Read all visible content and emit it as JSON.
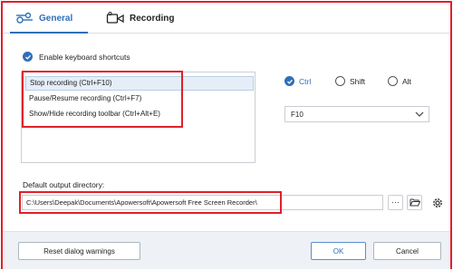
{
  "tabs": [
    {
      "label": "General",
      "icon": "sliders-icon",
      "active": true
    },
    {
      "label": "Recording",
      "icon": "video-camera-icon",
      "active": false
    }
  ],
  "keyboard": {
    "enable_label": "Enable keyboard shortcuts",
    "enabled": true,
    "items": [
      {
        "label": "Stop recording (Ctrl+F10)",
        "selected": true
      },
      {
        "label": "Pause/Resume recording (Ctrl+F7)",
        "selected": false
      },
      {
        "label": "Show/Hide recording toolbar (Ctrl+Alt+E)",
        "selected": false
      }
    ],
    "modifiers": [
      {
        "label": "Ctrl",
        "checked": true
      },
      {
        "label": "Shift",
        "checked": false
      },
      {
        "label": "Alt",
        "checked": false
      }
    ],
    "key_value": "F10"
  },
  "output": {
    "label": "Default output directory:",
    "path": "C:\\Users\\Deepak\\Documents\\Apowersoft\\Apowersoft Free Screen Recorder\\",
    "browse_label": "···"
  },
  "footer": {
    "reset_label": "Reset dialog warnings",
    "ok_label": "OK",
    "cancel_label": "Cancel"
  },
  "colors": {
    "accent": "#2f6fb8",
    "highlight": "#e0202a"
  }
}
